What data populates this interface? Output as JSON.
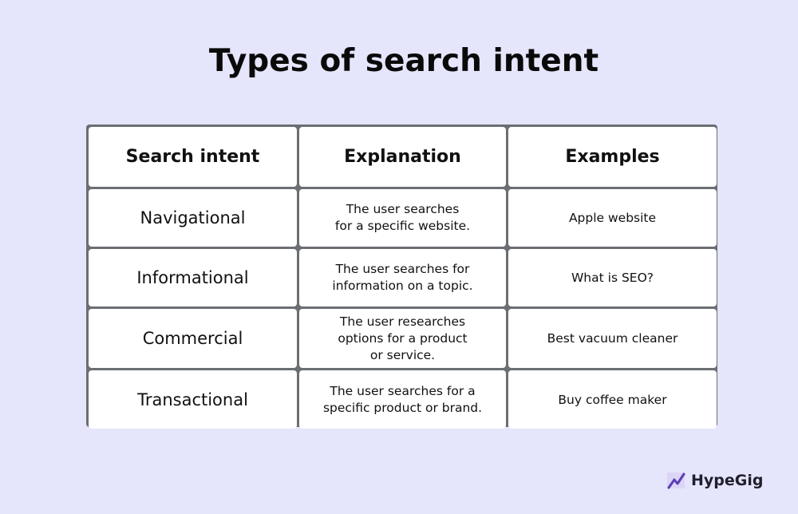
{
  "title": "Types of search intent",
  "table": {
    "headers": [
      "Search intent",
      "Explanation",
      "Examples"
    ],
    "rows": [
      {
        "intent": "Navigational",
        "explanation": "The user searches\nfor a specific website.",
        "example": "Apple website"
      },
      {
        "intent": "Informational",
        "explanation": "The user searches for\ninformation on a topic.",
        "example": "What is SEO?"
      },
      {
        "intent": "Commercial",
        "explanation": "The user researches\noptions for a product\nor service.",
        "example": "Best vacuum cleaner"
      },
      {
        "intent": "Transactional",
        "explanation": "The user searches for a\nspecific product or brand.",
        "example": "Buy coffee maker"
      }
    ]
  },
  "brand": {
    "name": "HypeGig",
    "icon": "trend-up-icon",
    "accent": "#5b3fb5"
  },
  "colors": {
    "background": "#e5e5fb",
    "grid_border": "#6b6e73",
    "cell": "#ffffff"
  }
}
